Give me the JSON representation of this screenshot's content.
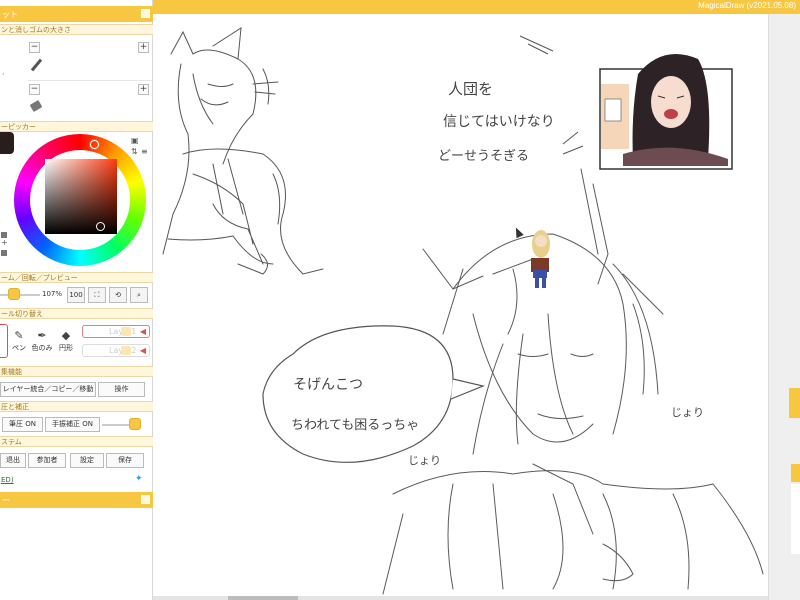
{
  "app": {
    "title": "MagicalDraw (v2021.05.08)"
  },
  "panel": {
    "header_label": "ット",
    "footer_label": "ー",
    "sections": {
      "brush_size": "ンと消しゴムの大きさ",
      "color_picker": "ーピッカー",
      "zoom": "ーム／回転／プレビュー",
      "tool_switch": "ール切り替え",
      "edit": "集機能",
      "pressure": "圧と補正",
      "system": "ステム"
    },
    "zoom": {
      "percent": "107%",
      "reset_label": "100"
    },
    "tools": [
      {
        "label": "ペン",
        "icon": "pen-icon"
      },
      {
        "label": "色のみ",
        "icon": "eyedropper-icon"
      },
      {
        "label": "円形",
        "icon": "eraser-icon"
      }
    ],
    "layers": [
      "Layer1",
      "Layer2"
    ],
    "edit_buttons": {
      "merge_copy_move": "レイヤー統合／コピー／移動",
      "operation": "操作"
    },
    "pressure_buttons": {
      "pen_pressure": "筆圧 ON",
      "stabilizer": "手振補正 ON"
    },
    "system_buttons": [
      "退出",
      "参加者",
      "設定",
      "保存"
    ],
    "link": "ED)"
  },
  "canvas": {
    "texts": {
      "note_line1": "人団を",
      "note_line2": "信じてはいけなり",
      "note_line3": "どーせうそぎる",
      "bubble_line1": "そげんこつ",
      "bubble_line2": "ちわれても困るっちゃ",
      "sfx_left": "じょり",
      "sfx_right": "じょり"
    }
  },
  "colors": {
    "accent": "#f7c742",
    "brush": "#2a1e1a"
  }
}
